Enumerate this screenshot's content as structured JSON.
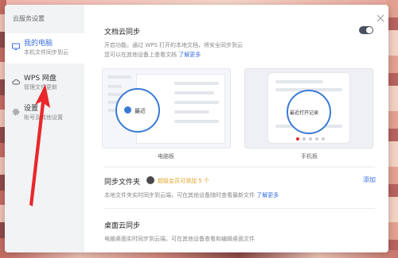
{
  "sidebar": {
    "title": "云服务设置",
    "items": [
      {
        "label": "我的电脑",
        "sub": "本机文件同步到云"
      },
      {
        "label": "WPS 网盘",
        "sub": "管理文件更新"
      },
      {
        "label": "设置",
        "sub": "账号及其他设置"
      }
    ]
  },
  "doc_sync": {
    "title": "文档云同步",
    "desc1": "开启功能，通过 WPS 打开的本地文档，将安全同步到云",
    "desc2": "您可以在其他设备上查看文档",
    "learn_more": "了解更多",
    "toggle_on": false,
    "pc_bubble": "最近",
    "mobile_bubble": "最近打开记录",
    "pc_caption": "电脑板",
    "mobile_caption": "手机板"
  },
  "sync_folder": {
    "title": "同步文件夹",
    "promo": "超级会员可添加 5 个",
    "add": "添加",
    "desc": "本地文件夹实时同步到云端，可在其他设备随时查看最新文件",
    "learn_more": "了解更多"
  },
  "desktop_sync": {
    "title": "桌面云同步",
    "desc": "电脑桌面实时同步到云端，可在其他设备查看和编辑桌面文件"
  },
  "colors": {
    "accent": "#3a6fe0",
    "promo": "#e0a022",
    "arrow": "#e8282a"
  }
}
